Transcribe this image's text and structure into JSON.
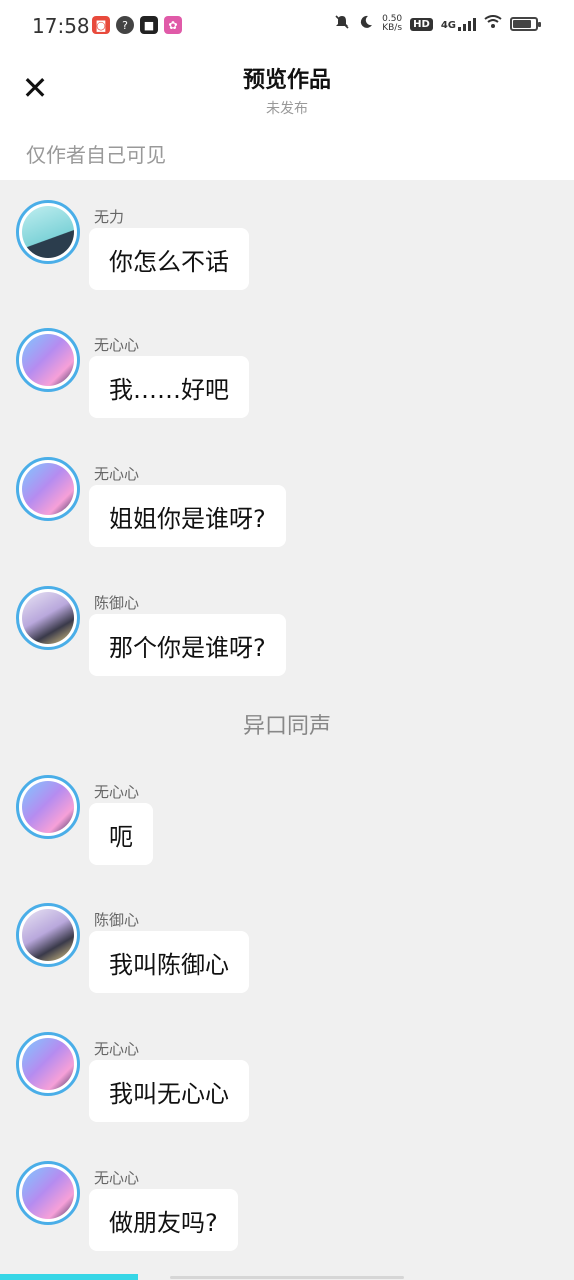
{
  "status_bar": {
    "time": "17:58",
    "net_speed_value": "0.50",
    "net_speed_unit": "KB/s",
    "hd_label": "HD",
    "network_label": "4G"
  },
  "header": {
    "title": "预览作品",
    "subtitle": "未发布",
    "close_icon": "close-icon"
  },
  "visibility_note": "仅作者自己可见",
  "messages": [
    {
      "sender": "无力",
      "text": "你怎么不话",
      "avatar": "avatar-wuli"
    },
    {
      "sender": "无心心",
      "text": "我……好吧",
      "avatar": "avatar-wuxinxin"
    },
    {
      "sender": "无心心",
      "text": "姐姐你是谁呀?",
      "avatar": "avatar-wuxinxin"
    },
    {
      "sender": "陈御心",
      "text": "那个你是谁呀?",
      "avatar": "avatar-chenyuxin"
    },
    {
      "sender": "无心心",
      "text": "呃",
      "avatar": "avatar-wuxinxin"
    },
    {
      "sender": "陈御心",
      "text": "我叫陈御心",
      "avatar": "avatar-chenyuxin"
    },
    {
      "sender": "无心心",
      "text": "我叫无心心",
      "avatar": "avatar-wuxinxin"
    },
    {
      "sender": "无心心",
      "text": "做朋友吗?",
      "avatar": "avatar-wuxinxin"
    }
  ],
  "narration": "异口同声",
  "colors": {
    "accent": "#36d6e6",
    "avatar_ring": "#4aaee8",
    "chat_background": "#f0f0f0"
  }
}
